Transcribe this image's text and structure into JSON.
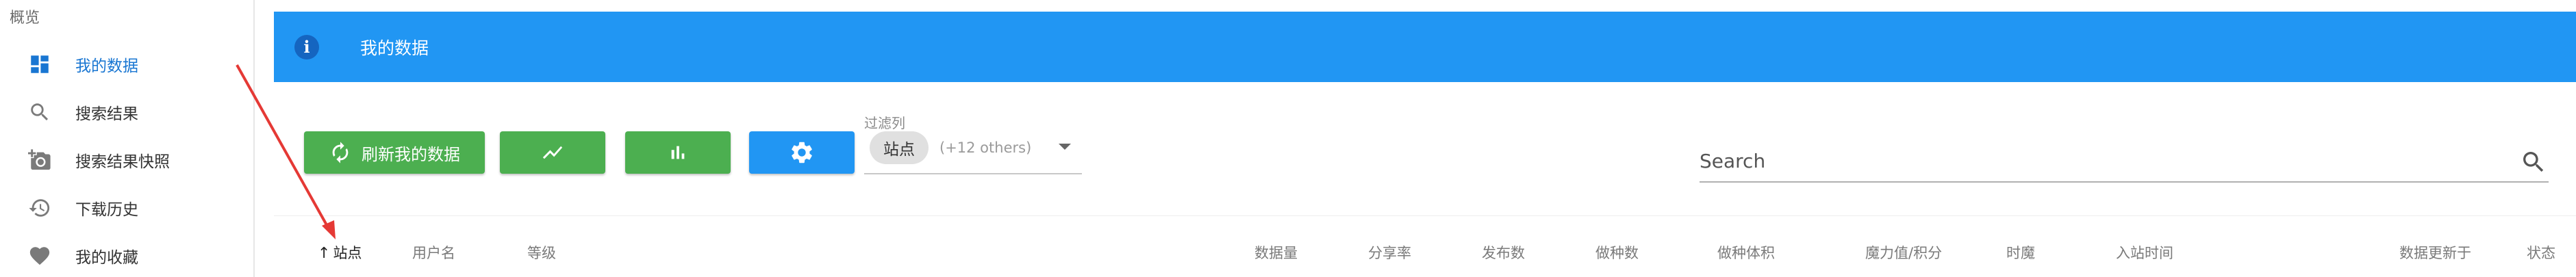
{
  "sidebar": {
    "section_title": "概览",
    "items": [
      {
        "label": "我的数据",
        "icon": "dashboard-icon",
        "active": true
      },
      {
        "label": "搜索结果",
        "icon": "search-icon",
        "active": false
      },
      {
        "label": "搜索结果快照",
        "icon": "add-photo-icon",
        "active": false
      },
      {
        "label": "下载历史",
        "icon": "history-icon",
        "active": false
      },
      {
        "label": "我的收藏",
        "icon": "heart-icon",
        "active": false
      }
    ]
  },
  "header": {
    "title": "我的数据",
    "icon": "info-icon",
    "color": "#2196f3"
  },
  "toolbar": {
    "refresh_label": "刷新我的数据",
    "chart_line_icon": "line-chart-icon",
    "chart_bar_icon": "bar-chart-icon",
    "settings_icon": "gear-icon",
    "green": "#4caf50",
    "blue": "#2196f3"
  },
  "filter": {
    "label": "过滤列",
    "chip": "站点",
    "others": "(+12 others)"
  },
  "search": {
    "placeholder": "Search"
  },
  "table": {
    "columns": [
      "站点",
      "用户名",
      "等级",
      "数据量",
      "分享率",
      "发布数",
      "做种数",
      "做种体积",
      "魔力值/积分",
      "时魔",
      "入站时间",
      "数据更新于",
      "状态"
    ],
    "sorted_column": "站点",
    "sort_direction": "asc"
  },
  "annotation": {
    "color": "#e53935"
  }
}
